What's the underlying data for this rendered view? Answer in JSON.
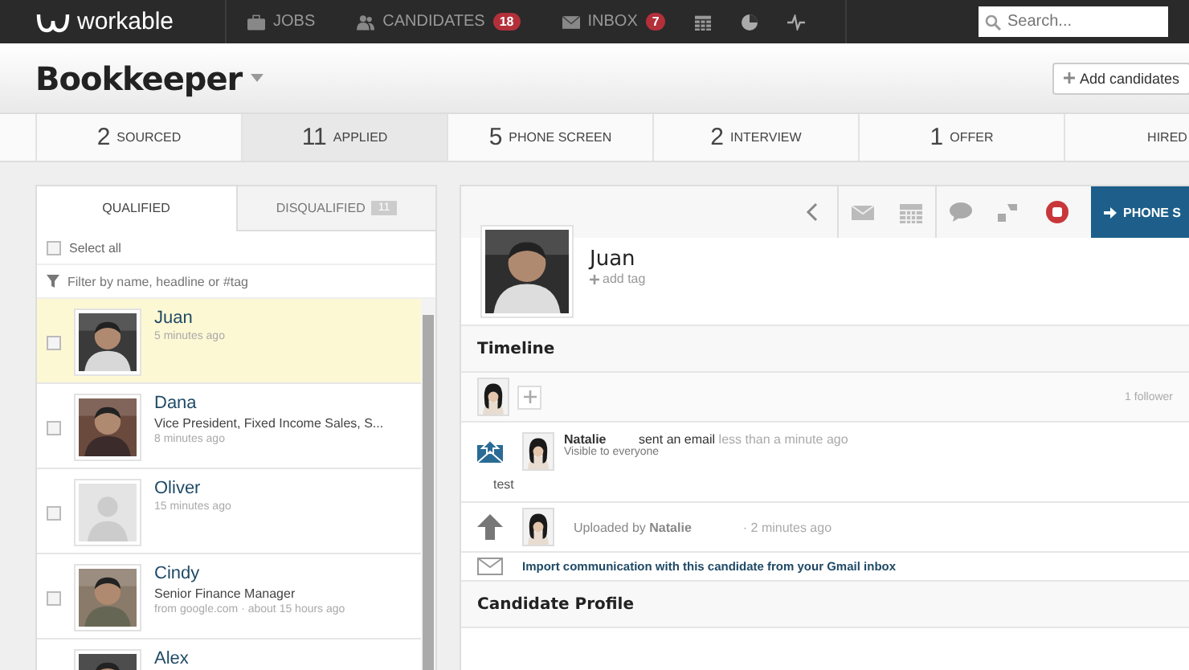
{
  "nav": {
    "logo": "workable",
    "items": [
      {
        "label": "JOBS"
      },
      {
        "label": "CANDIDATES",
        "badge": "18"
      },
      {
        "label": "INBOX",
        "badge": "7"
      }
    ],
    "search": {
      "placeholder": "Search..."
    }
  },
  "job": {
    "title": "Bookkeeper",
    "add_button": "Add candidates"
  },
  "stages": [
    {
      "count": "2",
      "label": "SOURCED",
      "selected": false
    },
    {
      "count": "11",
      "label": "APPLIED",
      "selected": true
    },
    {
      "count": "5",
      "label": "PHONE SCREEN",
      "selected": false
    },
    {
      "count": "2",
      "label": "INTERVIEW",
      "selected": false
    },
    {
      "count": "1",
      "label": "OFFER",
      "selected": false
    },
    {
      "label": "HIRED",
      "selected": false
    }
  ],
  "list_tabs": [
    {
      "label": "QUALIFIED",
      "selected": true
    },
    {
      "label": "DISQUALIFIED",
      "selected": false,
      "badge": "11"
    }
  ],
  "select_all": {
    "label": "Select all",
    "checked": false
  },
  "filter": {
    "placeholder": "Filter by name, headline or #tag"
  },
  "candidates": [
    {
      "name": "Juan",
      "time": "5 minutes ago",
      "kind": "picture",
      "selected": true,
      "checked": false
    },
    {
      "name": "Dana",
      "headline": "Vice President, Fixed Income Sales, S...",
      "time": "8 minutes ago",
      "kind": "picture",
      "selected": false,
      "checked": false
    },
    {
      "name": "Oliver",
      "time": "15 minutes ago",
      "kind": "placeholder",
      "selected": false,
      "checked": false
    },
    {
      "name": "Cindy",
      "headline": "Senior Finance Manager",
      "time": "from google.com · about 15 hours ago",
      "kind": "picture",
      "selected": false,
      "checked": false
    },
    {
      "name": "Alex",
      "kind": "picture",
      "selected": false
    }
  ],
  "detail": {
    "move_button": "PHONE S",
    "name": "Juan",
    "add_tag": "add tag",
    "timeline_title": "Timeline",
    "followers": "1 follower",
    "events": [
      {
        "kind": "email",
        "actor": "Natalie",
        "action": "sent an email",
        "time": "less than a minute ago",
        "visibility": "Visible to everyone",
        "body": "test"
      },
      {
        "kind": "upload",
        "text": "Uploaded by **Natalie**",
        "time": "· 2 minutes ago"
      },
      {
        "kind": "import",
        "text": "Import communication with this candidate from your Gmail inbox"
      }
    ],
    "profile_title": "Candidate Profile"
  }
}
